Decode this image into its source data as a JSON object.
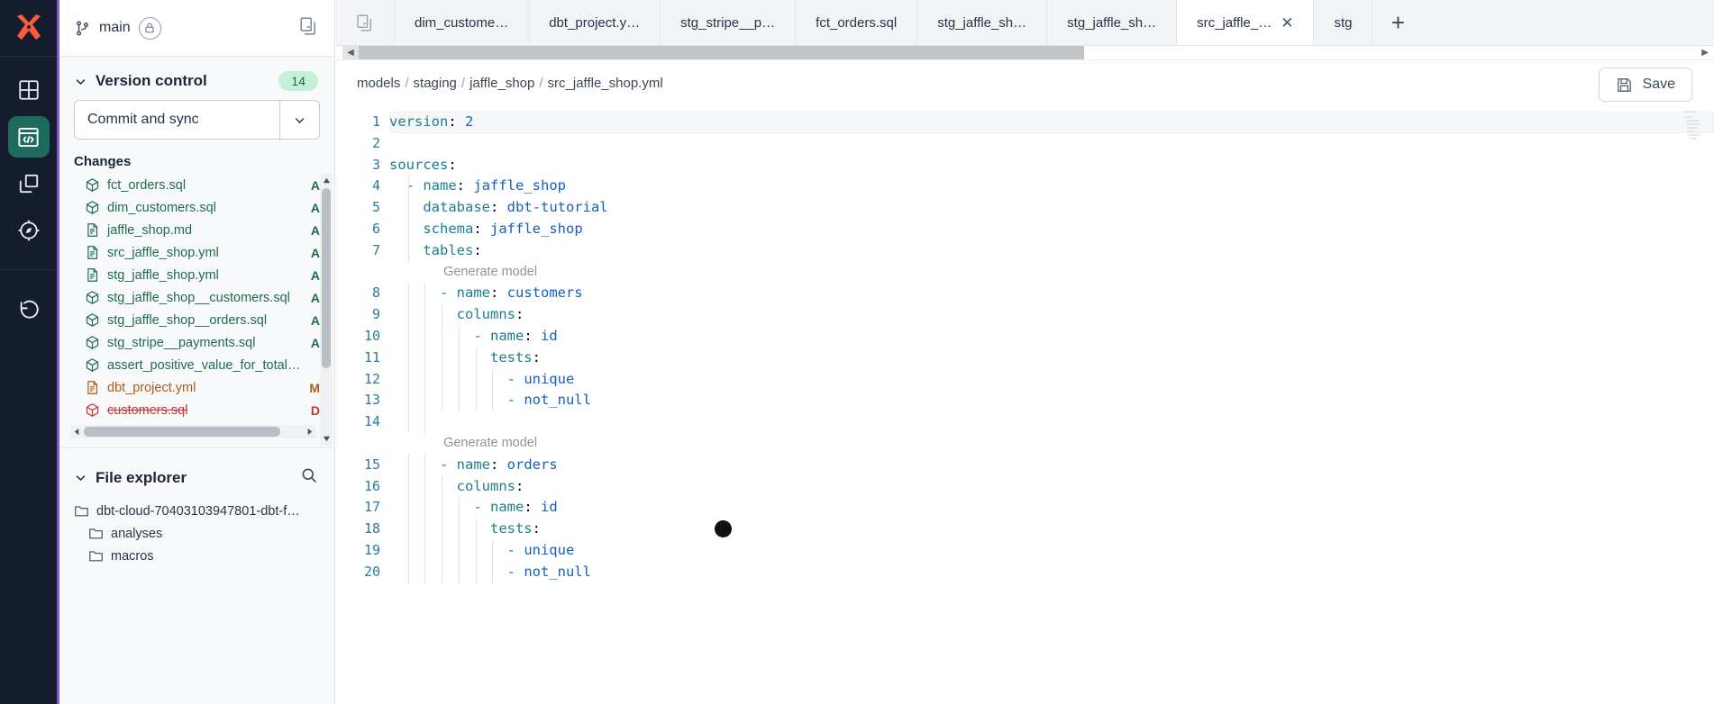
{
  "rail": {
    "logo_name": "dbt-logo",
    "items": [
      {
        "icon": "dashboard-grid-icon",
        "name": "rail-item-dashboard",
        "active": false
      },
      {
        "icon": "code-editor-icon",
        "name": "rail-item-develop",
        "active": true
      },
      {
        "icon": "layers-icon",
        "name": "rail-item-deploy",
        "active": false
      },
      {
        "icon": "compass-icon",
        "name": "rail-item-explore",
        "active": false
      },
      {
        "icon": "history-undo-icon",
        "name": "rail-item-history",
        "active": false
      }
    ]
  },
  "sidebar": {
    "branch": {
      "label": "main",
      "branch_icon": "git-branch-icon",
      "lock_icon": "lock-icon",
      "copy_icon": "copy-files-icon"
    },
    "version_control": {
      "title": "Version control",
      "count": "14",
      "chevron": "chevron-down-icon",
      "commit_button": "Commit and sync",
      "commit_caret": "chevron-down-icon"
    },
    "changes": {
      "label": "Changes",
      "items": [
        {
          "name": "fct_orders.sql",
          "status": "A",
          "kind": "model",
          "type": "add"
        },
        {
          "name": "dim_customers.sql",
          "status": "A",
          "kind": "model",
          "type": "add"
        },
        {
          "name": "jaffle_shop.md",
          "status": "A",
          "kind": "doc",
          "type": "add"
        },
        {
          "name": "src_jaffle_shop.yml",
          "status": "A",
          "kind": "doc",
          "type": "add"
        },
        {
          "name": "stg_jaffle_shop.yml",
          "status": "A",
          "kind": "doc",
          "type": "add"
        },
        {
          "name": "stg_jaffle_shop__customers.sql",
          "status": "A",
          "kind": "model",
          "type": "add"
        },
        {
          "name": "stg_jaffle_shop__orders.sql",
          "status": "A",
          "kind": "model",
          "type": "add"
        },
        {
          "name": "stg_stripe__payments.sql",
          "status": "A",
          "kind": "model",
          "type": "add"
        },
        {
          "name": "assert_positive_value_for_total_a…",
          "status": "",
          "kind": "model",
          "type": "add"
        },
        {
          "name": "dbt_project.yml",
          "status": "M",
          "kind": "doc",
          "type": "mod"
        },
        {
          "name": "customers.sql",
          "status": "D",
          "kind": "model",
          "type": "del"
        }
      ]
    },
    "file_explorer": {
      "title": "File explorer",
      "chevron": "chevron-down-icon",
      "search_icon": "search-icon",
      "tree": [
        {
          "label": "dbt-cloud-70403103947801-dbt-funda…",
          "icon": "folder-open-icon",
          "depth": 0
        },
        {
          "label": "analyses",
          "icon": "folder-icon",
          "depth": 1
        },
        {
          "label": "macros",
          "icon": "folder-icon",
          "depth": 1
        }
      ]
    }
  },
  "tabs": {
    "leading_icon": "copy-files-icon",
    "items": [
      {
        "label": "dim_custome…",
        "active": false,
        "closable": false
      },
      {
        "label": "dbt_project.y…",
        "active": false,
        "closable": false
      },
      {
        "label": "stg_stripe__p…",
        "active": false,
        "closable": false
      },
      {
        "label": "fct_orders.sql",
        "active": false,
        "closable": false
      },
      {
        "label": "stg_jaffle_sh…",
        "active": false,
        "closable": false
      },
      {
        "label": "stg_jaffle_sh…",
        "active": false,
        "closable": false
      },
      {
        "label": "src_jaffle_…",
        "active": true,
        "closable": true,
        "close_icon": "close-icon"
      },
      {
        "label": "stg",
        "active": false,
        "closable": false
      }
    ],
    "add_label": "+"
  },
  "breadcrumb": {
    "parts": [
      "models",
      "staging",
      "jaffle_shop",
      "src_jaffle_shop.yml"
    ],
    "separator": "/"
  },
  "save": {
    "label": "Save",
    "icon": "save-floppy-icon"
  },
  "editor": {
    "filename": "src_jaffle_shop.yml",
    "codelens_label": "Generate model",
    "lines": [
      {
        "num": "1",
        "tokens": [
          {
            "t": "version",
            "c": "k"
          },
          {
            "t": ": ",
            "c": "p"
          },
          {
            "t": "2",
            "c": "v"
          }
        ],
        "indent": 0,
        "current": true
      },
      {
        "num": "2",
        "tokens": [],
        "indent": 0
      },
      {
        "num": "3",
        "tokens": [
          {
            "t": "sources",
            "c": "k"
          },
          {
            "t": ":",
            "c": "p"
          }
        ],
        "indent": 0
      },
      {
        "num": "4",
        "tokens": [
          {
            "t": "  - ",
            "c": "d"
          },
          {
            "t": "name",
            "c": "k"
          },
          {
            "t": ": ",
            "c": "p"
          },
          {
            "t": "jaffle_shop",
            "c": "v"
          }
        ],
        "indent": 1
      },
      {
        "num": "5",
        "tokens": [
          {
            "t": "    ",
            "c": "p"
          },
          {
            "t": "database",
            "c": "k"
          },
          {
            "t": ": ",
            "c": "p"
          },
          {
            "t": "dbt-tutorial",
            "c": "v"
          }
        ],
        "indent": 1
      },
      {
        "num": "6",
        "tokens": [
          {
            "t": "    ",
            "c": "p"
          },
          {
            "t": "schema",
            "c": "k"
          },
          {
            "t": ": ",
            "c": "p"
          },
          {
            "t": "jaffle_shop",
            "c": "v"
          }
        ],
        "indent": 1
      },
      {
        "num": "7",
        "tokens": [
          {
            "t": "    ",
            "c": "p"
          },
          {
            "t": "tables",
            "c": "k"
          },
          {
            "t": ":",
            "c": "p"
          }
        ],
        "indent": 1
      },
      {
        "num": "",
        "lens": "Generate model",
        "lens_indent": 6
      },
      {
        "num": "8",
        "tokens": [
          {
            "t": "      - ",
            "c": "d"
          },
          {
            "t": "name",
            "c": "k"
          },
          {
            "t": ": ",
            "c": "p"
          },
          {
            "t": "customers",
            "c": "v"
          }
        ],
        "indent": 2
      },
      {
        "num": "9",
        "tokens": [
          {
            "t": "        ",
            "c": "p"
          },
          {
            "t": "columns",
            "c": "k"
          },
          {
            "t": ":",
            "c": "p"
          }
        ],
        "indent": 3
      },
      {
        "num": "10",
        "tokens": [
          {
            "t": "          - ",
            "c": "d"
          },
          {
            "t": "name",
            "c": "k"
          },
          {
            "t": ": ",
            "c": "p"
          },
          {
            "t": "id",
            "c": "v"
          }
        ],
        "indent": 4
      },
      {
        "num": "11",
        "tokens": [
          {
            "t": "            ",
            "c": "p"
          },
          {
            "t": "tests",
            "c": "k"
          },
          {
            "t": ":",
            "c": "p"
          }
        ],
        "indent": 5
      },
      {
        "num": "12",
        "tokens": [
          {
            "t": "              - ",
            "c": "d"
          },
          {
            "t": "unique",
            "c": "v"
          }
        ],
        "indent": 6
      },
      {
        "num": "13",
        "tokens": [
          {
            "t": "              - ",
            "c": "d"
          },
          {
            "t": "not_null",
            "c": "v"
          }
        ],
        "indent": 6
      },
      {
        "num": "14",
        "tokens": [],
        "indent": 2
      },
      {
        "num": "",
        "lens": "Generate model",
        "lens_indent": 6
      },
      {
        "num": "15",
        "tokens": [
          {
            "t": "      - ",
            "c": "d"
          },
          {
            "t": "name",
            "c": "k"
          },
          {
            "t": ": ",
            "c": "p"
          },
          {
            "t": "orders",
            "c": "v"
          }
        ],
        "indent": 2
      },
      {
        "num": "16",
        "tokens": [
          {
            "t": "        ",
            "c": "p"
          },
          {
            "t": "columns",
            "c": "k"
          },
          {
            "t": ":",
            "c": "p"
          }
        ],
        "indent": 3
      },
      {
        "num": "17",
        "tokens": [
          {
            "t": "          - ",
            "c": "d"
          },
          {
            "t": "name",
            "c": "k"
          },
          {
            "t": ": ",
            "c": "p"
          },
          {
            "t": "id",
            "c": "v"
          }
        ],
        "indent": 4
      },
      {
        "num": "18",
        "tokens": [
          {
            "t": "            ",
            "c": "p"
          },
          {
            "t": "tests",
            "c": "k"
          },
          {
            "t": ":",
            "c": "p"
          }
        ],
        "indent": 5
      },
      {
        "num": "19",
        "tokens": [
          {
            "t": "              - ",
            "c": "d"
          },
          {
            "t": "unique",
            "c": "v"
          }
        ],
        "indent": 6
      },
      {
        "num": "20",
        "tokens": [
          {
            "t": "              - ",
            "c": "d"
          },
          {
            "t": "not_null",
            "c": "v"
          }
        ],
        "indent": 6
      }
    ]
  },
  "colors": {
    "rail_bg": "#141c2e",
    "rail_accent": "#7b5cc9",
    "rail_active": "#1c6b5c",
    "brand_orange": "#fb5c3a",
    "added_green": "#1f6b52",
    "modified_orange": "#b15a14",
    "deleted_red": "#cc3333",
    "count_pill_bg": "#c5f0d8",
    "yaml_key": "#1a7f8e",
    "yaml_value": "#1560bd",
    "line_number": "#2c7a9c"
  }
}
